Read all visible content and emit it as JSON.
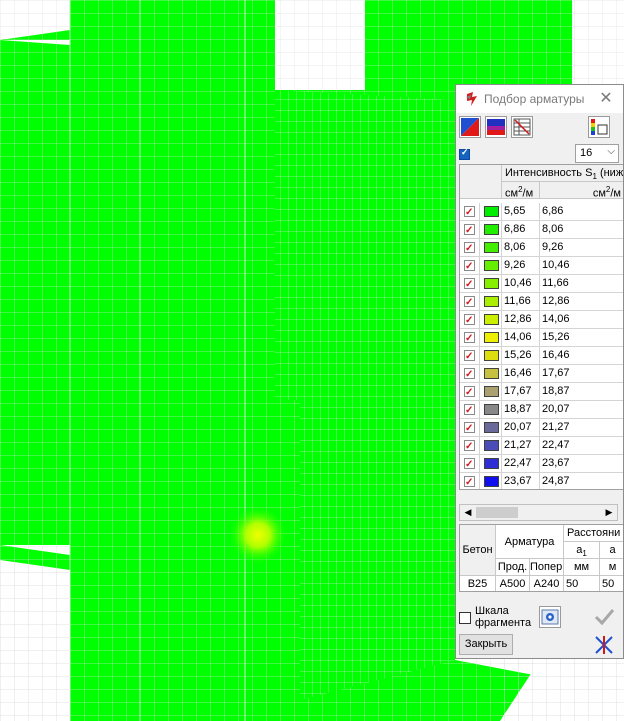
{
  "window": {
    "title": "Подбор арматуры",
    "close_glyph": "✕"
  },
  "toolbar": {
    "icons": [
      "color-scale-icon",
      "color-scale-blue-icon",
      "grid-table-icon",
      "palette-settings-icon"
    ]
  },
  "scale_count": "16",
  "table": {
    "header_title": "Интенсивность S",
    "header_subscript": "1",
    "header_suffix": " (ниж",
    "unit_base": "см",
    "unit_exp": "2",
    "unit_tail": "/м",
    "rows": [
      {
        "from": "5,65",
        "to": "6,86",
        "color": "#00ee00"
      },
      {
        "from": "6,86",
        "to": "8,06",
        "color": "#22ee00"
      },
      {
        "from": "8,06",
        "to": "9,26",
        "color": "#44ee00"
      },
      {
        "from": "9,26",
        "to": "10,46",
        "color": "#66ee00"
      },
      {
        "from": "10,46",
        "to": "11,66",
        "color": "#88ee00"
      },
      {
        "from": "11,66",
        "to": "12,86",
        "color": "#aaee00"
      },
      {
        "from": "12,86",
        "to": "14,06",
        "color": "#ccee00"
      },
      {
        "from": "14,06",
        "to": "15,26",
        "color": "#eeee00"
      },
      {
        "from": "15,26",
        "to": "16,46",
        "color": "#dddd10"
      },
      {
        "from": "16,46",
        "to": "17,67",
        "color": "#c8c040"
      },
      {
        "from": "17,67",
        "to": "18,87",
        "color": "#aaa070"
      },
      {
        "from": "18,87",
        "to": "20,07",
        "color": "#888888"
      },
      {
        "from": "20,07",
        "to": "21,27",
        "color": "#6a6a9a"
      },
      {
        "from": "21,27",
        "to": "22,47",
        "color": "#4c4cb8"
      },
      {
        "from": "22,47",
        "to": "23,67",
        "color": "#2e2ed4"
      },
      {
        "from": "23,67",
        "to": "24,87",
        "color": "#1010ee"
      }
    ]
  },
  "rebar": {
    "h_concrete": "Бетон",
    "h_reinf": "Арматура",
    "h_dist": "Расстояни",
    "h_a1": "a",
    "h_a1_sub": "1",
    "h_long": "Прод.",
    "h_trans": "Попер.",
    "h_mm1": "мм",
    "h_mm2": "м",
    "v_concrete": "B25",
    "v_long": "A500",
    "v_trans": "A240",
    "v_a1": "50",
    "v_a2": "50"
  },
  "fragment_scale_label_1": "Шкала",
  "fragment_scale_label_2": "фрагмента",
  "close_button": "Закрыть",
  "colors": {
    "mesh_fill": "#00ff00",
    "mesh_grid": "#c8c8c8",
    "hotspot": "#f0ff00"
  }
}
